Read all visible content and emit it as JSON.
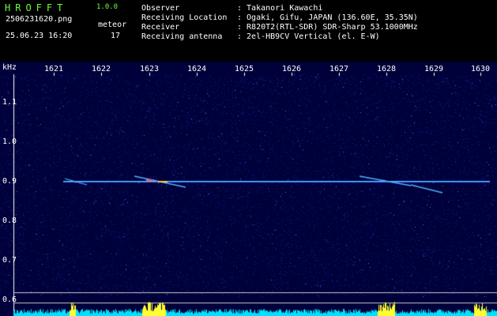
{
  "app": {
    "logo": "HROFFT",
    "version": "1.0.0",
    "filename": "2506231620.png",
    "timestamp": "25.06.23 16:20",
    "meteor_label": "meteor",
    "meteor_count": "17"
  },
  "info": [
    {
      "label": "Observer",
      "value": ": Takanori Kawachi"
    },
    {
      "label": "Receiving Location",
      "value": ": Ogaki, Gifu, JAPAN (136.60E, 35.35N)"
    },
    {
      "label": "Receiver",
      "value": ": R820T2(RTL-SDR) SDR-Sharp 53.1000MHz"
    },
    {
      "label": "Receiving antenna",
      "value": ": 2el-HB9CV Vertical (el. E-W)"
    }
  ],
  "axes": {
    "y_unit": "kHz",
    "x_ticks": [
      "1621",
      "1622",
      "1623",
      "1624",
      "1625",
      "1626",
      "1627",
      "1628",
      "1629",
      "1630"
    ],
    "y_ticks": [
      "1.1",
      "1.0",
      "0.9",
      "0.8",
      "0.7",
      "0.6"
    ]
  },
  "colors": {
    "background": "#00003a",
    "signal": "#58c8ff",
    "level": "#00e0ff",
    "burst": "#ffff30",
    "logo": "#6cff3c"
  }
}
